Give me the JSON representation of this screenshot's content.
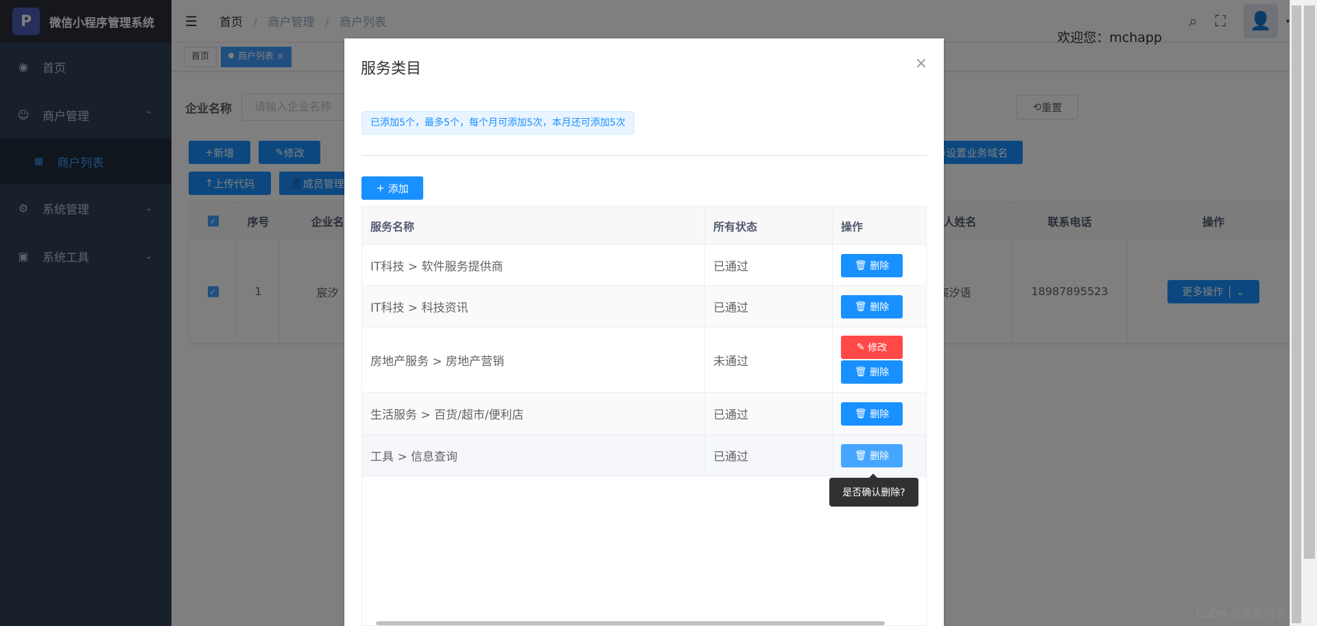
{
  "app": {
    "title": "微信小程序管理系统",
    "logo": "P"
  },
  "sidebar": {
    "items": [
      {
        "label": "首页",
        "icon": "dashboard-icon"
      },
      {
        "label": "商户管理",
        "icon": "merchant-icon",
        "arrow": "⌃"
      },
      {
        "label": "商户列表",
        "icon": "table-icon"
      },
      {
        "label": "系统管理",
        "icon": "gear-icon",
        "arrow": "⌄"
      },
      {
        "label": "系统工具",
        "icon": "toolbox-icon",
        "arrow": "⌄"
      }
    ]
  },
  "header": {
    "breadcrumb": [
      "首页",
      "商户管理",
      "商户列表"
    ],
    "welcome": "欢迎您：mchapp"
  },
  "tags": [
    "首页",
    "商户列表"
  ],
  "search": {
    "label": "企业名称",
    "placeholder": "请输入企业名称",
    "reset": "重置"
  },
  "toolbar": {
    "add": "新增",
    "edit": "修改",
    "upload": "上传代码",
    "members": "成员管理",
    "domain": "设置业务域名"
  },
  "bg_table": {
    "headers": [
      "序号",
      "企业名",
      "法人姓名",
      "联系电话",
      "操作"
    ],
    "row": {
      "index": "1",
      "company": "宸汐",
      "legal": "宸汐语",
      "phone": "18987895523",
      "more": "更多操作"
    }
  },
  "dialog": {
    "title": "服务类目",
    "alert": "已添加5个，最多5个，每个月可添加5次，本月还可添加5次",
    "add": "添加",
    "headers": [
      "服务名称",
      "所有状态",
      "操作"
    ],
    "rows": [
      {
        "name": "IT科技 > 软件服务提供商",
        "status": "已通过"
      },
      {
        "name": "IT科技 > 科技资讯",
        "status": "已通过"
      },
      {
        "name": "房地产服务 > 房地产营销",
        "status": "未通过"
      },
      {
        "name": "生活服务 > 百货/超市/便利店",
        "status": "已通过"
      },
      {
        "name": "工具 > 信息查询",
        "status": "已通过"
      }
    ],
    "delete": "删除",
    "edit": "修改",
    "popover": "是否确认删除?"
  },
  "watermark": "CSDN @悟空码字"
}
